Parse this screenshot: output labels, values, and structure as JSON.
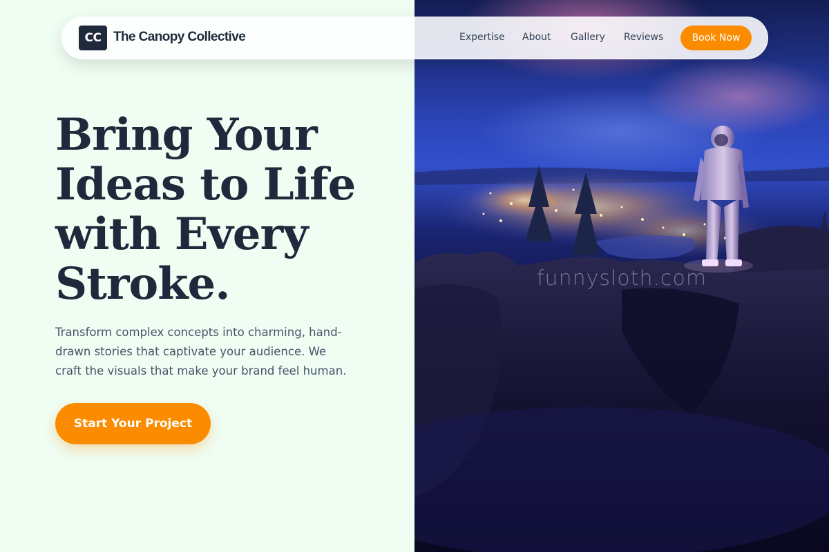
{
  "brand": {
    "logo_initials": "CC",
    "name": "The Canopy Collective"
  },
  "nav": {
    "links": [
      "Expertise",
      "About",
      "Gallery",
      "Reviews"
    ],
    "cta_label": "Book Now"
  },
  "hero": {
    "headline": "Bring Your Ideas to Life with Every Stroke.",
    "subtext": "Transform complex concepts into charming, hand-drawn stories that captivate your audience. We craft the visuals that make your brand feel human.",
    "cta_label": "Start Your Project"
  },
  "image": {
    "watermark": "funnysloth.com"
  },
  "colors": {
    "accent": "#fb8c00",
    "text_dark": "#1e293b",
    "background": "#effdf3"
  }
}
